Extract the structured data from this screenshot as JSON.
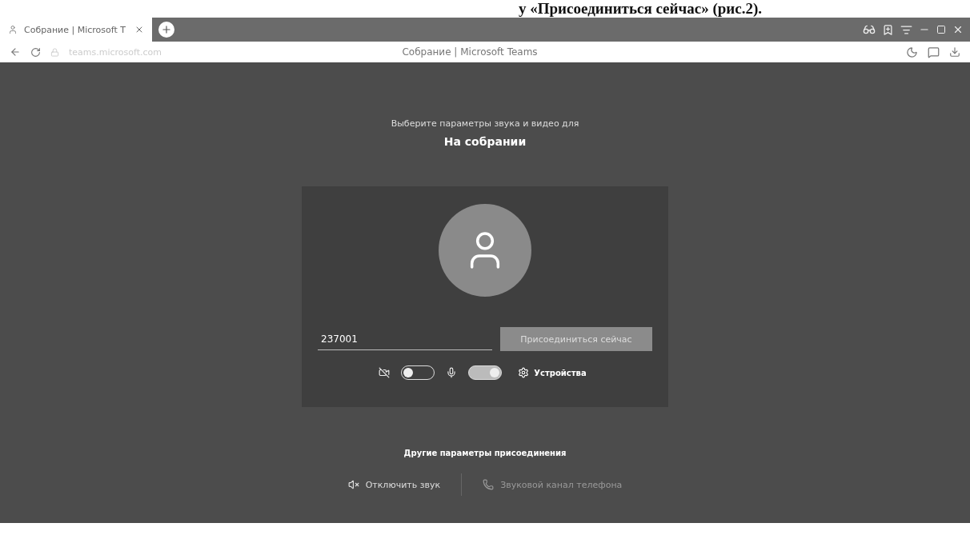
{
  "caption": "у «Присоединиться сейчас» (рис.2).",
  "browser": {
    "tab": {
      "title": "Собрание | Microsoft T",
      "selected": true
    },
    "address": "teams.microsoft.com",
    "page_title": "Собрание | Microsoft Teams"
  },
  "prejoin": {
    "subtitle": "Выберите параметры звука и видео для",
    "title": "На собрании",
    "name_field": {
      "value": "237001"
    },
    "join_button": "Присоединиться сейчас",
    "controls": [
      {
        "kind": "video",
        "on": false
      },
      {
        "kind": "mic",
        "on": true
      }
    ],
    "devices": "Устройства",
    "other_heading": "Другие параметры присоединения",
    "other_options": [
      {
        "kind": "mute",
        "label": "Отключить звук",
        "disabled": false
      },
      {
        "kind": "phone",
        "label": "Звуковой канал телефона",
        "disabled": true
      }
    ]
  }
}
